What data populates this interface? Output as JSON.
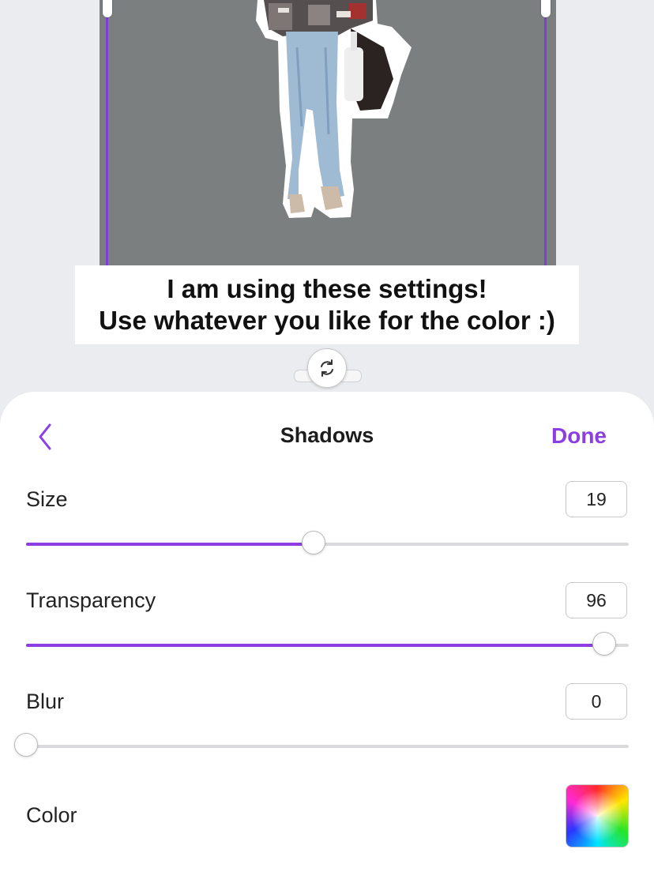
{
  "canvas": {
    "caption_lines": [
      "I am using these settings!",
      "Use whatever you like for the color :)"
    ]
  },
  "panel": {
    "title": "Shadows",
    "done_label": "Done",
    "back_icon": "chevron-left-icon",
    "rotate_icon": "rotate-icon",
    "accent_color": "#8b3fe2",
    "controls": [
      {
        "label": "Size",
        "value": "19",
        "fraction": 0.477
      },
      {
        "label": "Transparency",
        "value": "96",
        "fraction": 0.96
      },
      {
        "label": "Blur",
        "value": "0",
        "fraction": 0.0
      }
    ],
    "color_label": "Color"
  }
}
